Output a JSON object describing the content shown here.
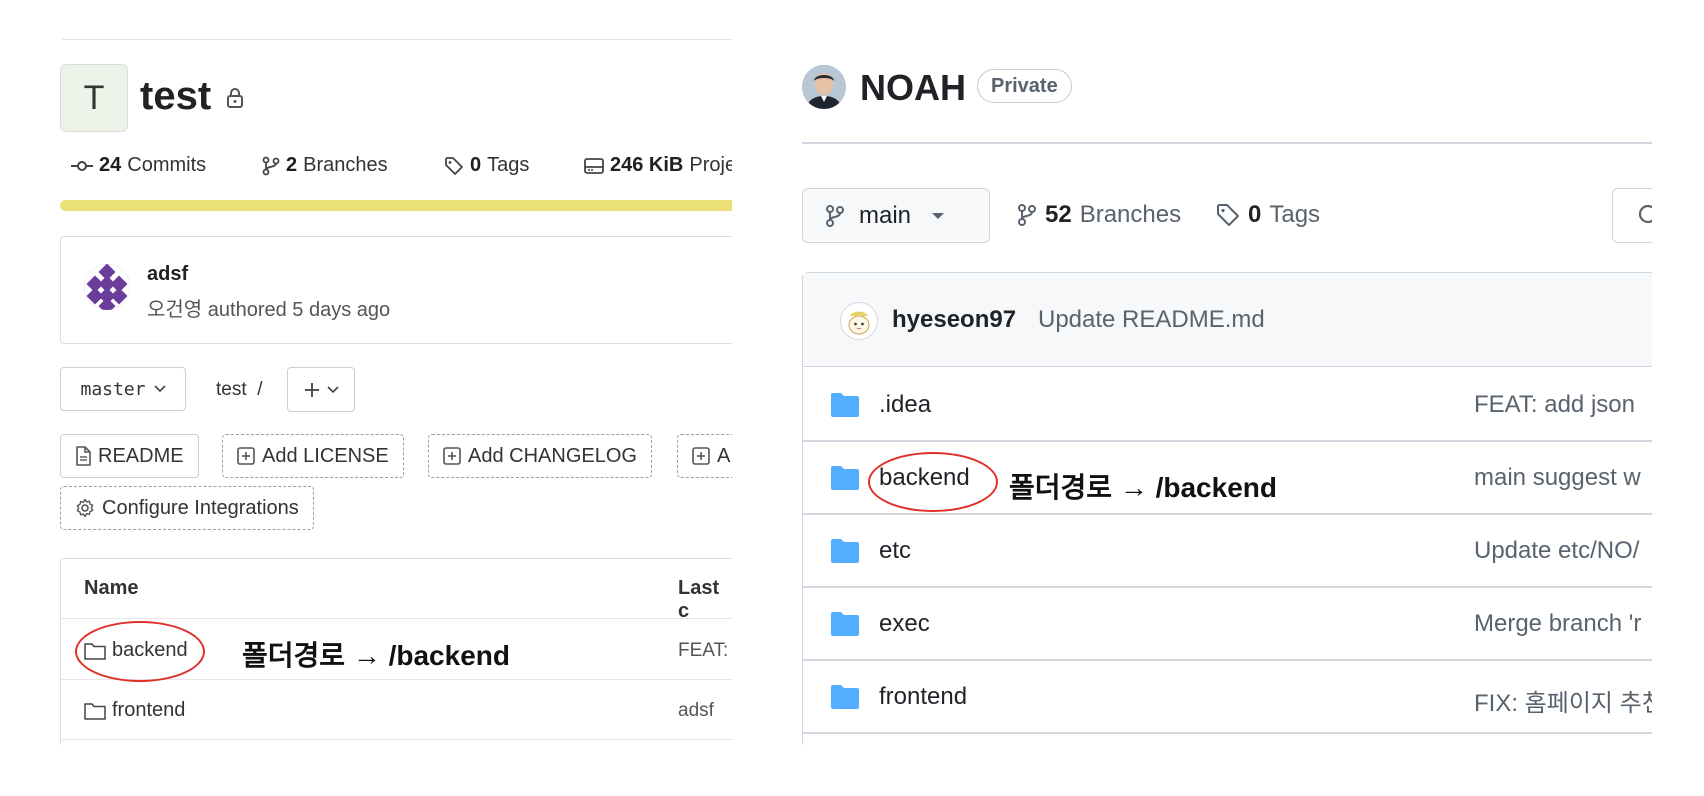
{
  "gitlab": {
    "project_avatar_letter": "T",
    "project_name": "test",
    "stats": [
      {
        "icon": "commit-icon",
        "count": "24",
        "label": "Commits"
      },
      {
        "icon": "branch-icon",
        "count": "2",
        "label": "Branches"
      },
      {
        "icon": "tag-icon",
        "count": "0",
        "label": "Tags"
      },
      {
        "icon": "storage-icon",
        "count": "246 KiB",
        "label": "Proje"
      }
    ],
    "last_commit": {
      "title": "adsf",
      "author": "오건영",
      "meta": "authored 5 days ago"
    },
    "branch_selector": "master",
    "path": {
      "root": "test",
      "sep": "/"
    },
    "action_chips": [
      "README",
      "Add LICENSE",
      "Add CHANGELOG",
      "A",
      "Configure Integrations"
    ],
    "table": {
      "headers": {
        "name": "Name",
        "last_commit": "Last c"
      },
      "rows": [
        {
          "name": "backend",
          "message": "FEAT:"
        },
        {
          "name": "frontend",
          "message": "adsf"
        }
      ]
    },
    "annotation": "폴더경로 → /backend"
  },
  "github": {
    "repo_name": "NOAH",
    "visibility": "Private",
    "branch_selector": "main",
    "branches": {
      "count": "52",
      "label": "Branches"
    },
    "tags": {
      "count": "0",
      "label": "Tags"
    },
    "latest_commit": {
      "user": "hyeseon97",
      "message": "Update README.md"
    },
    "rows": [
      {
        "name": ".idea",
        "message": "FEAT: add json"
      },
      {
        "name": "backend",
        "message": "main suggest w"
      },
      {
        "name": "etc",
        "message": "Update etc/NO/"
      },
      {
        "name": "exec",
        "message": "Merge branch 'r"
      },
      {
        "name": "frontend",
        "message": "FIX: 홈페이지 추천"
      }
    ],
    "annotation": "폴더경로 → /backend"
  },
  "colors": {
    "highlight_ellipse": "#e0302a",
    "gitlab_progress": "#ebe176",
    "github_folder": "#54aeff"
  }
}
